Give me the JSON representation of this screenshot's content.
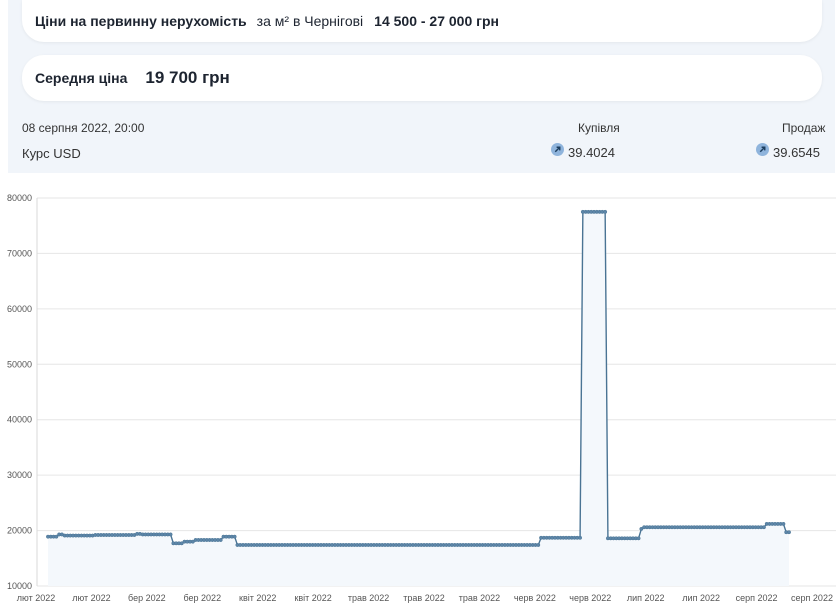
{
  "header": {
    "title": "Ціни на первинну нерухомість",
    "subtitle": "за м² в Чернігові",
    "range": "14 500 - 27 000 грн"
  },
  "average": {
    "label": "Середня ціна",
    "value": "19 700 грн"
  },
  "rates": {
    "datetime": "08 серпня 2022, 20:00",
    "buy_header": "Купівля",
    "sell_header": "Продаж",
    "currency": "Курс USD",
    "buy": "39.4024",
    "sell": "39.6545",
    "buy_icon": "arrow-up-right-icon",
    "sell_icon": "arrow-up-right-icon"
  },
  "chart_data": {
    "type": "line",
    "ylim": [
      10000,
      80000
    ],
    "yticks": [
      "10000",
      "20000",
      "30000",
      "40000",
      "50000",
      "60000",
      "70000",
      "80000"
    ],
    "xticks": [
      "лют 2022",
      "лют 2022",
      "бер 2022",
      "бер 2022",
      "квіт 2022",
      "квіт 2022",
      "трав 2022",
      "трав 2022",
      "трав 2022",
      "черв 2022",
      "черв 2022",
      "лип 2022",
      "лип 2022",
      "серп 2022",
      "серп 2022"
    ],
    "grid": true,
    "line_color": "#4a7494",
    "fill_color": "#f4f8fc",
    "series": [
      {
        "values": [
          18900,
          18900,
          18900,
          18900,
          19300,
          19300,
          19100,
          19100,
          19100,
          19100,
          19100,
          19100,
          19100,
          19100,
          19100,
          19100,
          19100,
          19200,
          19200,
          19200,
          19200,
          19200,
          19200,
          19200,
          19200,
          19200,
          19200,
          19200,
          19200,
          19200,
          19200,
          19200,
          19400,
          19400,
          19300,
          19300,
          19300,
          19300,
          19300,
          19300,
          19300,
          19300,
          19300,
          19300,
          19300,
          17700,
          17700,
          17700,
          17700,
          18000,
          18000,
          18000,
          18000,
          18300,
          18300,
          18300,
          18300,
          18300,
          18300,
          18300,
          18300,
          18300,
          18300,
          18900,
          18900,
          18900,
          18900,
          18900,
          17400,
          17400,
          17400,
          17400,
          17400,
          17400,
          17400,
          17400,
          17400,
          17400,
          17400,
          17400,
          17400,
          17400,
          17400,
          17400,
          17400,
          17400,
          17400,
          17400,
          17400,
          17400,
          17400,
          17400,
          17400,
          17400,
          17400,
          17400,
          17400,
          17400,
          17400,
          17400,
          17400,
          17400,
          17400,
          17400,
          17400,
          17400,
          17400,
          17400,
          17400,
          17400,
          17400,
          17400,
          17400,
          17400,
          17400,
          17400,
          17400,
          17400,
          17400,
          17400,
          17400,
          17400,
          17400,
          17400,
          17400,
          17400,
          17400,
          17400,
          17400,
          17400,
          17400,
          17400,
          17400,
          17400,
          17400,
          17400,
          17400,
          17400,
          17400,
          17400,
          17400,
          17400,
          17400,
          17400,
          17400,
          17400,
          17400,
          17400,
          17400,
          17400,
          17400,
          17400,
          17400,
          17400,
          17400,
          17400,
          17400,
          17400,
          17400,
          17400,
          17400,
          17400,
          17400,
          17400,
          17400,
          17400,
          17400,
          17400,
          17400,
          17400,
          17400,
          17400,
          17400,
          17400,
          17400,
          17400,
          17400,
          18700,
          18700,
          18700,
          18700,
          18700,
          18700,
          18700,
          18700,
          18700,
          18700,
          18700,
          18700,
          18700,
          18700,
          18700,
          77500,
          77500,
          77500,
          77500,
          77500,
          77500,
          77500,
          77500,
          77500,
          18600,
          18600,
          18600,
          18600,
          18600,
          18600,
          18600,
          18600,
          18600,
          18600,
          18600,
          18600,
          20300,
          20600,
          20600,
          20600,
          20600,
          20600,
          20600,
          20600,
          20600,
          20600,
          20600,
          20600,
          20600,
          20600,
          20600,
          20600,
          20600,
          20600,
          20600,
          20600,
          20600,
          20600,
          20600,
          20600,
          20600,
          20600,
          20600,
          20600,
          20600,
          20600,
          20600,
          20600,
          20600,
          20600,
          20600,
          20600,
          20600,
          20600,
          20600,
          20600,
          20600,
          20600,
          20600,
          20600,
          20600,
          21200,
          21200,
          21200,
          21200,
          21200,
          21200,
          21200,
          19700,
          19700
        ]
      }
    ]
  }
}
